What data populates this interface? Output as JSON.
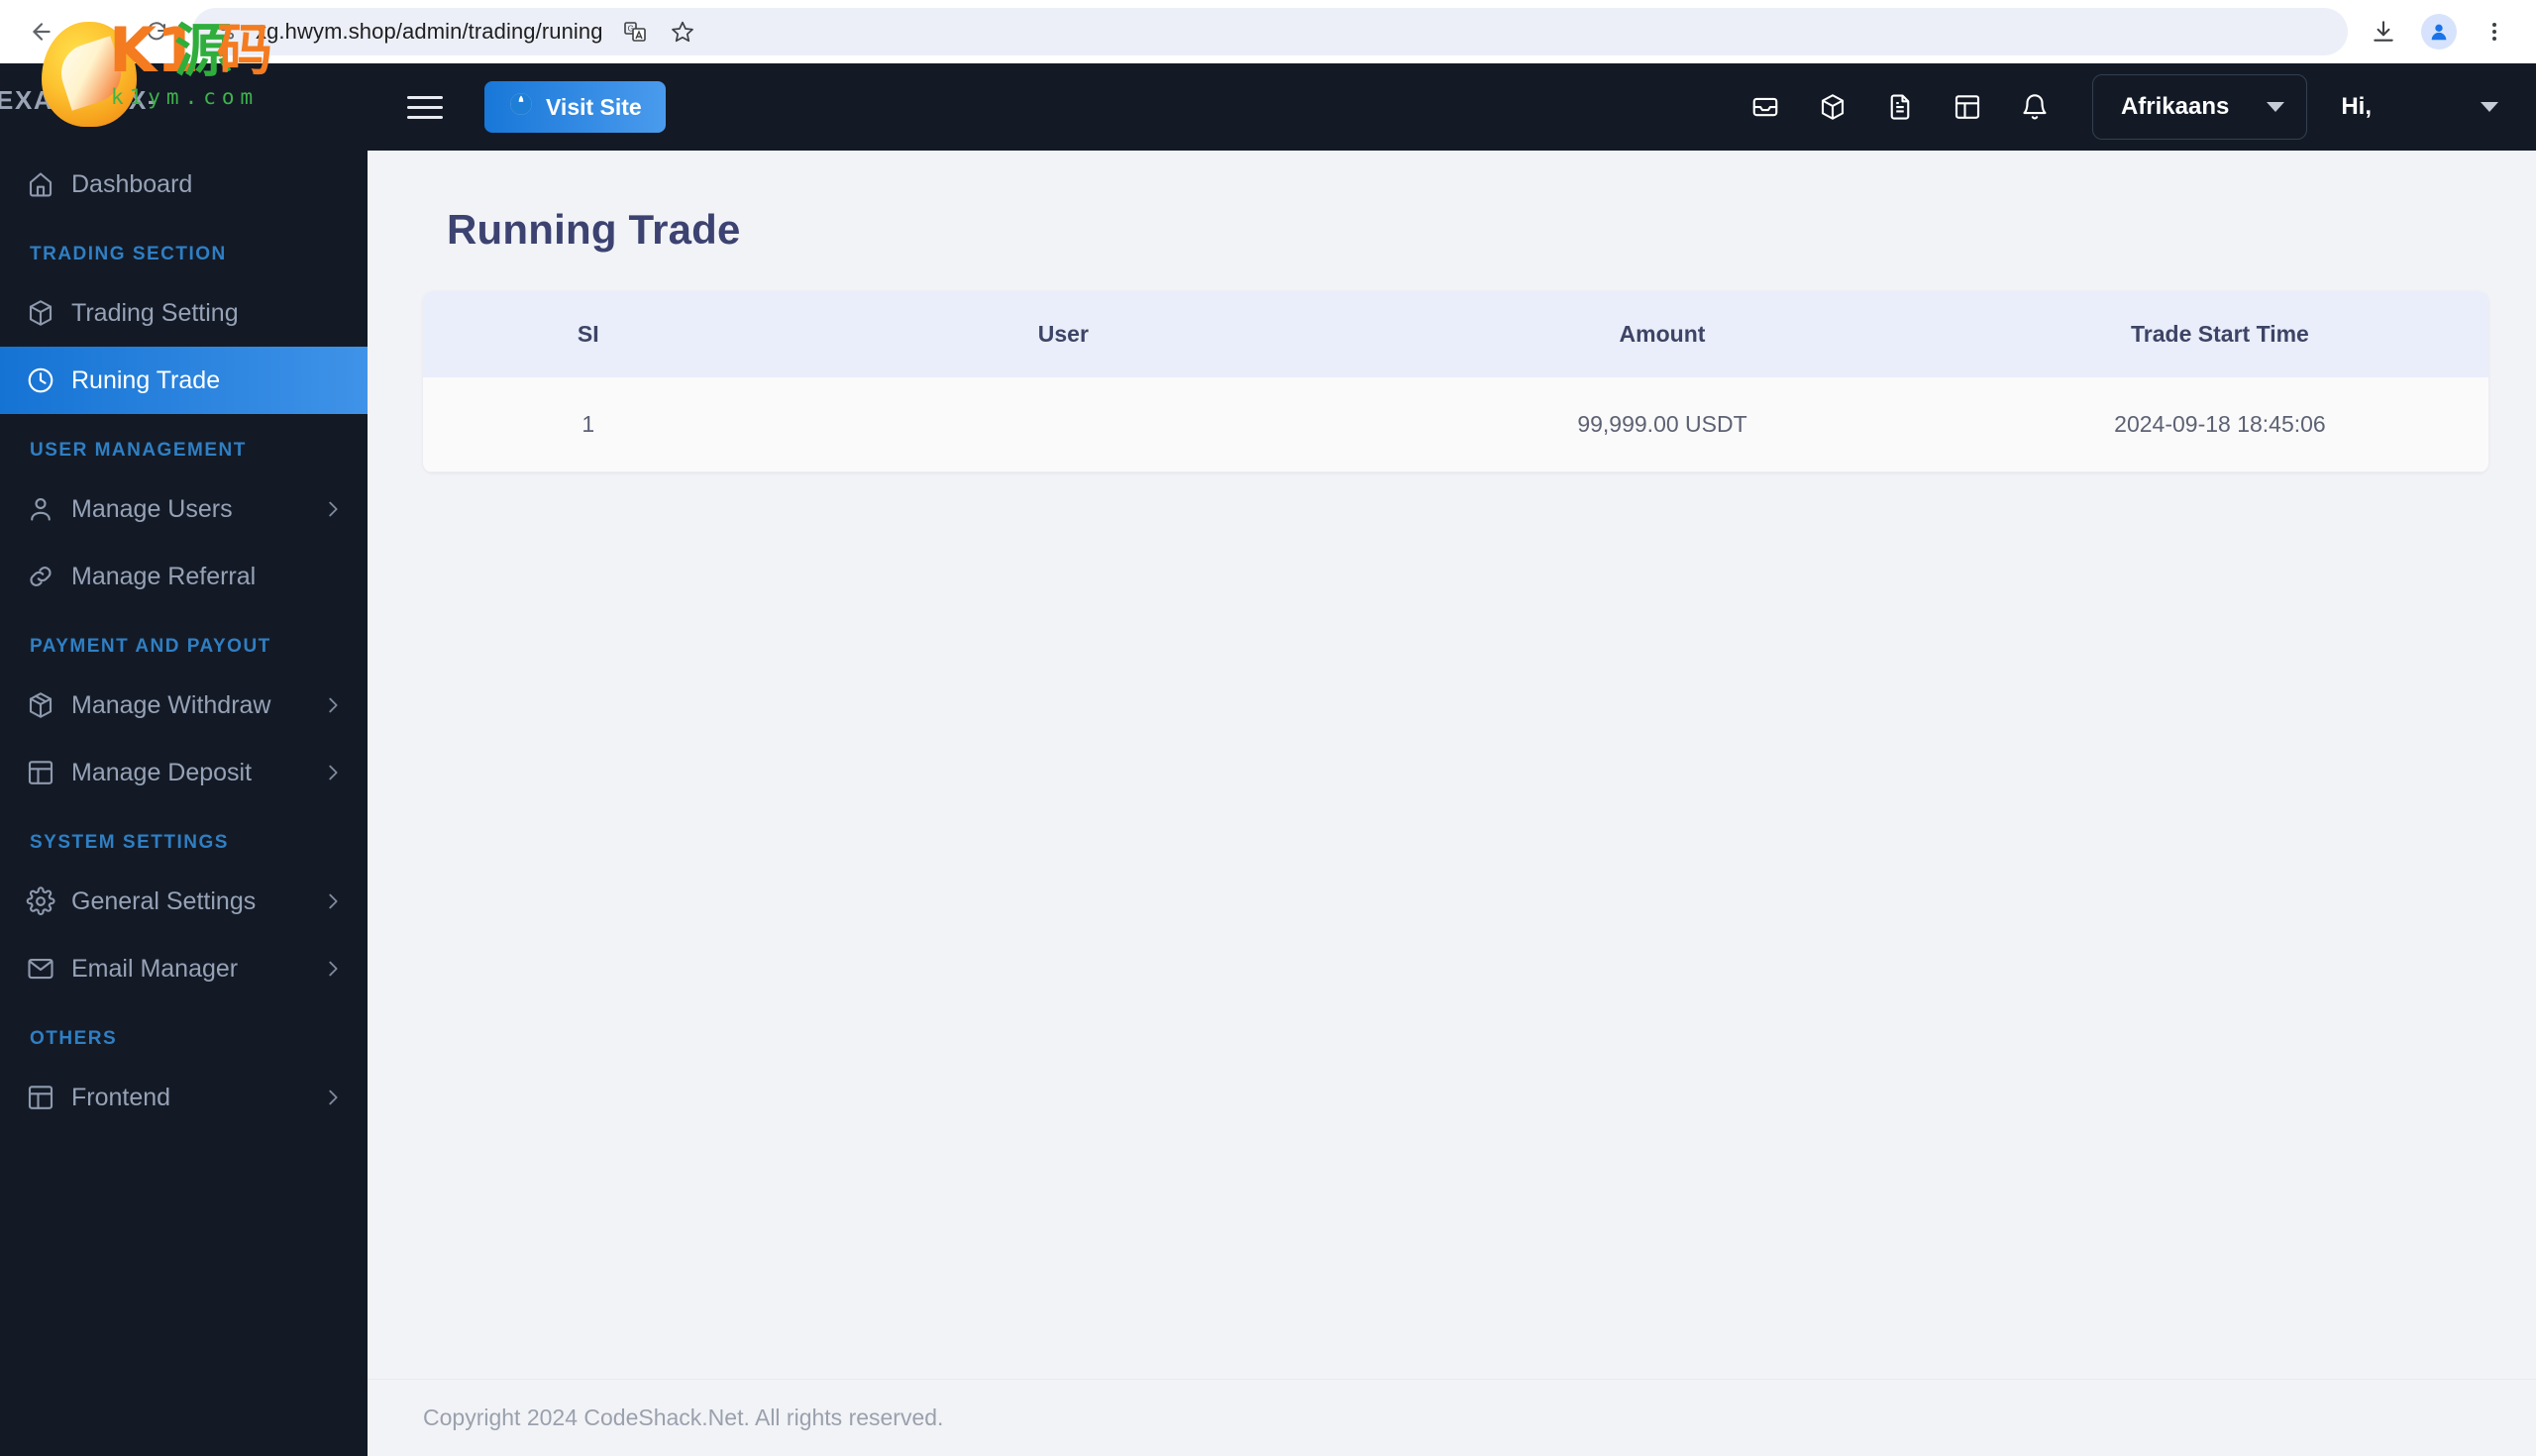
{
  "browser": {
    "url": "xg.hwym.shop/admin/trading/runing",
    "back_icon": "back-arrow-icon",
    "forward_icon": "forward-arrow-icon",
    "reload_icon": "reload-icon",
    "site_info_icon": "site-settings-icon",
    "translate_icon": "translate-icon",
    "bookmark_icon": "star-icon",
    "download_icon": "download-icon",
    "profile_icon": "profile-avatar-icon",
    "menu_icon": "three-dot-menu-icon"
  },
  "watermark": {
    "title": "K1",
    "cn_char_1": "源",
    "cn_char_2": "码",
    "domain": "k1ym.com"
  },
  "sidebar": {
    "brand": "EXABYTEX-",
    "groups": [
      {
        "label": "",
        "items": [
          {
            "label": "Dashboard",
            "icon": "home-icon",
            "active": false,
            "has_chevron": false
          }
        ]
      },
      {
        "label": "TRADING SECTION",
        "items": [
          {
            "label": "Trading Setting",
            "icon": "box-icon",
            "active": false,
            "has_chevron": false
          },
          {
            "label": "Runing Trade",
            "icon": "clock-icon",
            "active": true,
            "has_chevron": false
          }
        ]
      },
      {
        "label": "USER MANAGEMENT",
        "items": [
          {
            "label": "Manage Users",
            "icon": "user-icon",
            "active": false,
            "has_chevron": true
          },
          {
            "label": "Manage Referral",
            "icon": "link-icon",
            "active": false,
            "has_chevron": false
          }
        ]
      },
      {
        "label": "PAYMENT AND PAYOUT",
        "items": [
          {
            "label": "Manage Withdraw",
            "icon": "package-icon",
            "active": false,
            "has_chevron": true
          },
          {
            "label": "Manage Deposit",
            "icon": "table-icon",
            "active": false,
            "has_chevron": true
          }
        ]
      },
      {
        "label": "SYSTEM SETTINGS",
        "items": [
          {
            "label": "General Settings",
            "icon": "gear-icon",
            "active": false,
            "has_chevron": true
          },
          {
            "label": "Email Manager",
            "icon": "envelope-icon",
            "active": false,
            "has_chevron": true
          }
        ]
      },
      {
        "label": "OTHERS",
        "items": [
          {
            "label": "Frontend",
            "icon": "layout-icon",
            "active": false,
            "has_chevron": true
          }
        ]
      }
    ]
  },
  "topbar": {
    "menu_toggle": "hamburger-icon",
    "visit_site_label": "Visit Site",
    "visit_site_icon": "globe-icon",
    "icons": [
      "inbox-icon",
      "box-icon",
      "document-icon",
      "table-icon",
      "bell-icon"
    ],
    "language_selected": "Afrikaans",
    "greeting": "Hi,"
  },
  "main": {
    "page_title": "Running Trade",
    "table": {
      "columns": [
        "SI",
        "User",
        "Amount",
        "Trade Start Time"
      ],
      "rows": [
        {
          "si": "1",
          "user": "",
          "amount": "99,999.00 USDT",
          "time": "2024-09-18 18:45:06"
        }
      ]
    }
  },
  "footer": {
    "copyright": "Copyright 2024 CodeShack.Net. All rights reserved."
  },
  "colors": {
    "sidebar_bg": "#131a26",
    "accent_blue": "#1877d8",
    "accent_blue_light": "#4a9bed",
    "group_label": "#2f7fc4",
    "page_title": "#3c4371",
    "table_header_bg": "#eaeefb"
  }
}
